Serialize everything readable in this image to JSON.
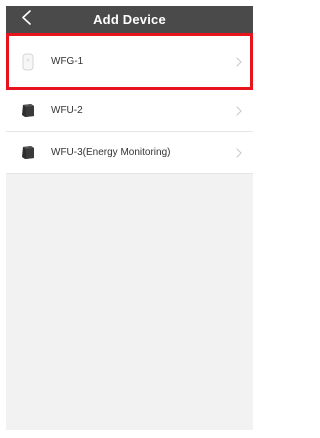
{
  "header": {
    "title": "Add Device",
    "back_icon": "chevron-left-icon"
  },
  "devices": [
    {
      "label": "WFG-1",
      "icon": "white-sensor-icon",
      "selected": true
    },
    {
      "label": "WFU-2",
      "icon": "black-plug-icon",
      "selected": false
    },
    {
      "label": "WFU-3(Energy Monitoring)",
      "icon": "black-plug-icon",
      "selected": false
    }
  ],
  "colors": {
    "header_bg": "#4a4a4a",
    "selection_outline": "#e8141d",
    "page_bg": "#f2f2f2"
  }
}
